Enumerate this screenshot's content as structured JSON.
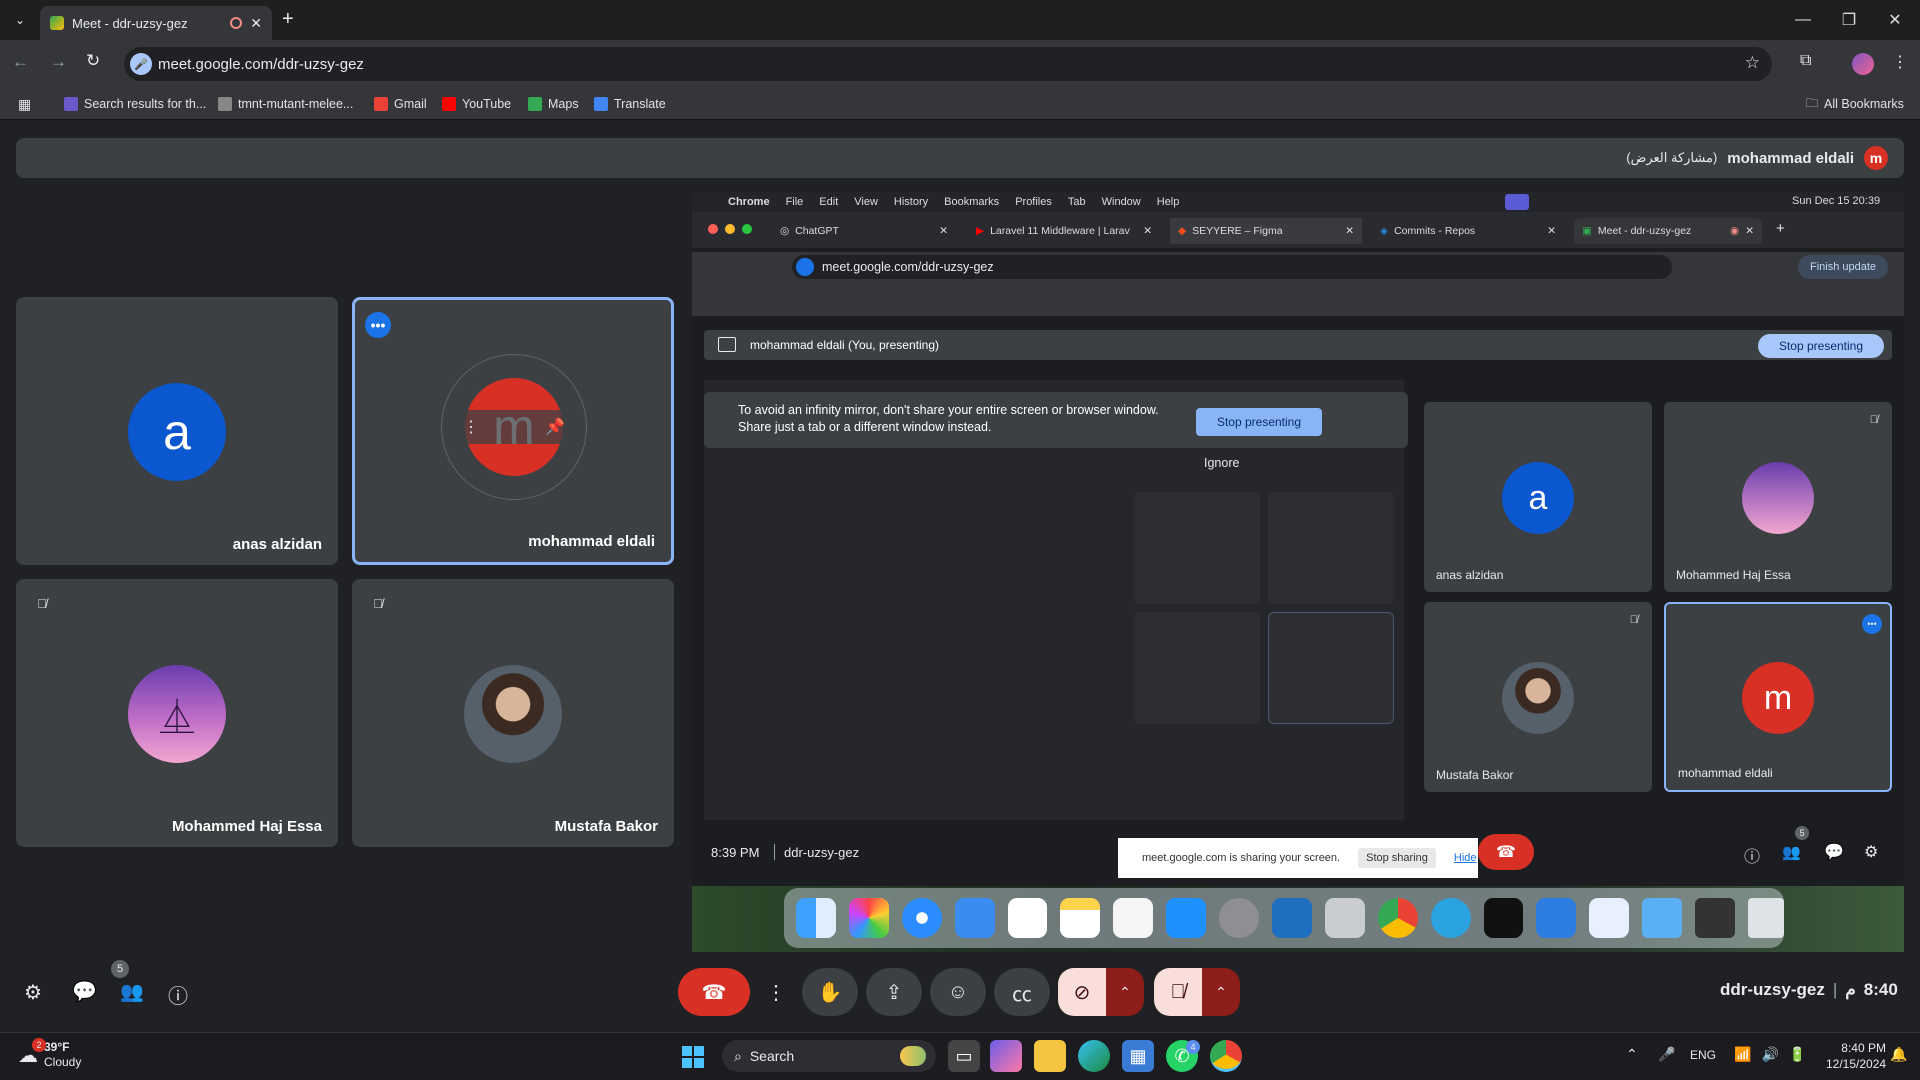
{
  "browser": {
    "tab_title": "Meet - ddr-uzsy-gez",
    "url": "meet.google.com/ddr-uzsy-gez",
    "bookmarks": [
      {
        "label": "Search results for th...",
        "icon": "search-results-icon",
        "color": "#6a5acd"
      },
      {
        "label": "tmnt-mutant-melee...",
        "icon": "document-icon",
        "color": "#888888"
      },
      {
        "label": "Gmail",
        "icon": "gmail-icon",
        "color": "#ea4335"
      },
      {
        "label": "YouTube",
        "icon": "youtube-icon",
        "color": "#ff0000"
      },
      {
        "label": "Maps",
        "icon": "maps-icon",
        "color": "#34a853"
      },
      {
        "label": "Translate",
        "icon": "translate-icon",
        "color": "#4285f4"
      }
    ],
    "all_bookmarks": "All Bookmarks"
  },
  "meet": {
    "banner_name": "mohammad eldali",
    "banner_sharing": "(مشاركة العرض)",
    "banner_avatar": "m",
    "participants": [
      {
        "name": "anas alzidan",
        "initial": "a",
        "color": "#0b57d0"
      },
      {
        "name": "mohammad eldali",
        "initial": "m",
        "color": "#d93025"
      },
      {
        "name": "Mohammed Haj Essa",
        "initial": "",
        "color": "#7e57c2"
      },
      {
        "name": "Mustafa Bakor",
        "initial": "",
        "color": "#5f6368"
      }
    ],
    "meeting_code": "ddr-uzsy-gez",
    "time": "8:40",
    "time_suffix": "م",
    "participants_count": "5"
  },
  "shared": {
    "mac_menu": [
      "Chrome",
      "File",
      "Edit",
      "View",
      "History",
      "Bookmarks",
      "Profiles",
      "Tab",
      "Window",
      "Help"
    ],
    "mac_clock": "Sun Dec 15  20:39",
    "tabs": [
      "ChatGPT",
      "Laravel 11 Middleware | Larav",
      "SEYYERE – Figma",
      "Commits - Repos",
      "Meet - ddr-uzsy-gez"
    ],
    "url": "meet.google.com/ddr-uzsy-gez",
    "finish_update": "Finish update",
    "presenting_text": "mohammad eldali (You, presenting)",
    "stop_presenting": "Stop presenting",
    "warning_line1": "To avoid an infinity mirror, don't share your entire screen or browser window.",
    "warning_line2": "Share just a tab or a different window instead.",
    "warning_button": "Stop presenting",
    "ignore": "Ignore",
    "tiles": [
      {
        "name": "anas alzidan",
        "initial": "a"
      },
      {
        "name": "Mohammed Haj Essa",
        "initial": ""
      },
      {
        "name": "Mustafa Bakor",
        "initial": ""
      },
      {
        "name": "mohammad eldali",
        "initial": "m"
      }
    ],
    "inner_time": "8:39 PM",
    "inner_code": "ddr-uzsy-gez",
    "inner_count": "5",
    "sharing_notice": "meet.google.com is sharing your screen.",
    "stop_sharing": "Stop sharing",
    "hide": "Hide"
  },
  "taskbar": {
    "weather_temp": "39°F",
    "weather_desc": "Cloudy",
    "weather_badge": "2",
    "search": "Search",
    "lang": "ENG",
    "time": "8:40 PM",
    "date": "12/15/2024",
    "whatsapp_badge": "4"
  }
}
